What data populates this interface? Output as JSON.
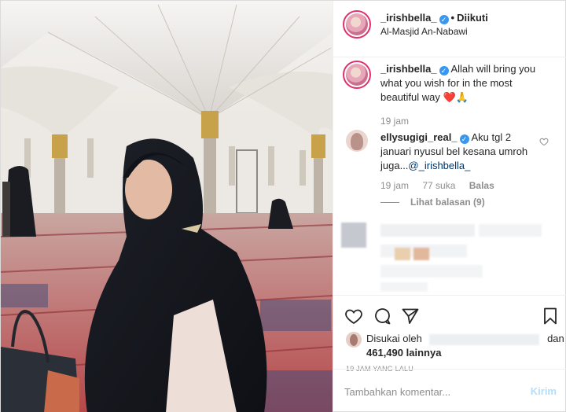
{
  "post": {
    "username": "_irishbella_",
    "follow_status": "Diikuti",
    "dot": "•",
    "location": "Al-Masjid An-Nabawi",
    "verified_mark": "✓"
  },
  "caption": {
    "username": "_irishbella_",
    "text": "Allah will bring you what you wish for in the most beautiful way",
    "emoji": "❤️🙏",
    "time": "19 jam"
  },
  "comment": {
    "username": "ellysugigi_real_",
    "text": "Aku tgl 2 januari nyusul bel kesana umroh juga...",
    "mention": "@_irishbella_",
    "time": "19 jam",
    "likes": "77 suka",
    "reply_label": "Balas",
    "view_replies": "Lihat balasan (9)"
  },
  "likes": {
    "prefix": "Disukai oleh",
    "suffix": "dan",
    "count": "461,490",
    "others": "lainnya"
  },
  "timestamp": "19 JAM YANG LALU",
  "add_comment": {
    "placeholder": "Tambahkan komentar...",
    "post_label": "Kirim"
  },
  "icons": {
    "like": "heart-icon",
    "comment": "comment-icon",
    "share": "share-icon",
    "save": "bookmark-icon",
    "verified": "verified-badge-icon"
  },
  "colors": {
    "verified_blue": "#3897f0",
    "text": "#262626",
    "muted": "#8e8e8e",
    "post_button": "#b2dffc",
    "border": "#dbdbdb"
  }
}
